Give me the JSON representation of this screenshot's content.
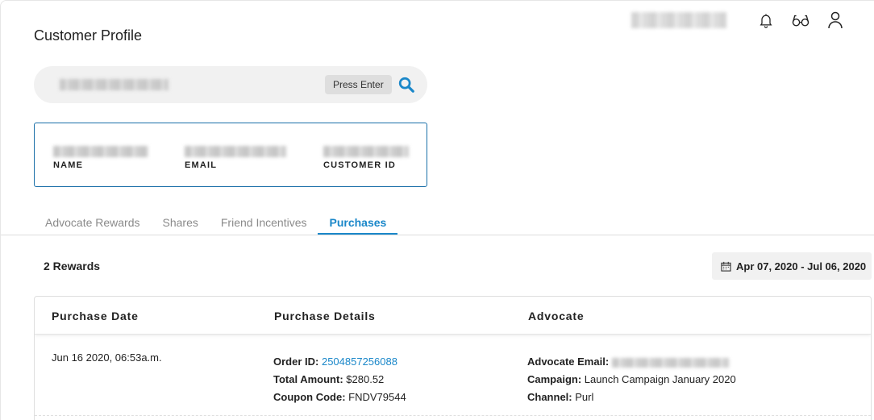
{
  "page": {
    "title": "Customer Profile"
  },
  "search": {
    "hint": "Press Enter"
  },
  "profile": {
    "name_label": "NAME",
    "email_label": "EMAIL",
    "customer_id_label": "CUSTOMER ID"
  },
  "tabs": [
    {
      "label": "Advocate Rewards",
      "active": false
    },
    {
      "label": "Shares",
      "active": false
    },
    {
      "label": "Friend Incentives",
      "active": false
    },
    {
      "label": "Purchases",
      "active": true
    }
  ],
  "summary": {
    "rewards_count": "2 Rewards",
    "date_range": "Apr 07, 2020 - Jul 06, 2020"
  },
  "table": {
    "headers": [
      "Purchase Date",
      "Purchase Details",
      "Advocate"
    ],
    "rows": [
      {
        "purchase_date": "Jun 16 2020, 06:53a.m.",
        "order_id_label": "Order ID:",
        "order_id": "2504857256088",
        "total_label": "Total Amount:",
        "total": "$280.52",
        "coupon_label": "Coupon Code:",
        "coupon": "FNDV79544",
        "advocate_email_label": "Advocate Email:",
        "campaign_label": "Campaign:",
        "campaign": "Launch Campaign January 2020",
        "channel_label": "Channel:",
        "channel": "Purl"
      }
    ]
  },
  "colors": {
    "accent": "#1a87c9",
    "card_border": "#1a6fa8"
  },
  "icons": [
    "bell-icon",
    "glasses-icon",
    "user-icon",
    "search-icon",
    "calendar-icon"
  ]
}
